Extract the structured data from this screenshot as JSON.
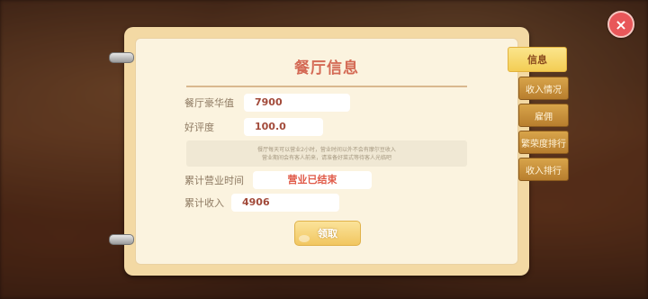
{
  "dialog": {
    "title": "餐厅信息",
    "luxury_label": "餐厅豪华值",
    "luxury_value": "7900",
    "rating_label": "好评度",
    "rating_value": "100.0",
    "notice_line1": "餐厅每天可以营业2小时，营业时间以外不会有摩尔豆收入",
    "notice_line2": "营业期间会有客人前来，请准备好菜式等待客人光临吧",
    "hours_label": "累计营业时间",
    "hours_status": "营业已结束",
    "income_label": "累计收入",
    "income_value": "4906",
    "claim_label": "领取"
  },
  "tabs": [
    {
      "label": "信息",
      "active": true
    },
    {
      "label": "收入情况",
      "active": false
    },
    {
      "label": "雇佣",
      "active": false
    },
    {
      "label": "繁荣度排行",
      "active": false
    },
    {
      "label": "收入排行",
      "active": false
    }
  ],
  "close_icon": "×"
}
